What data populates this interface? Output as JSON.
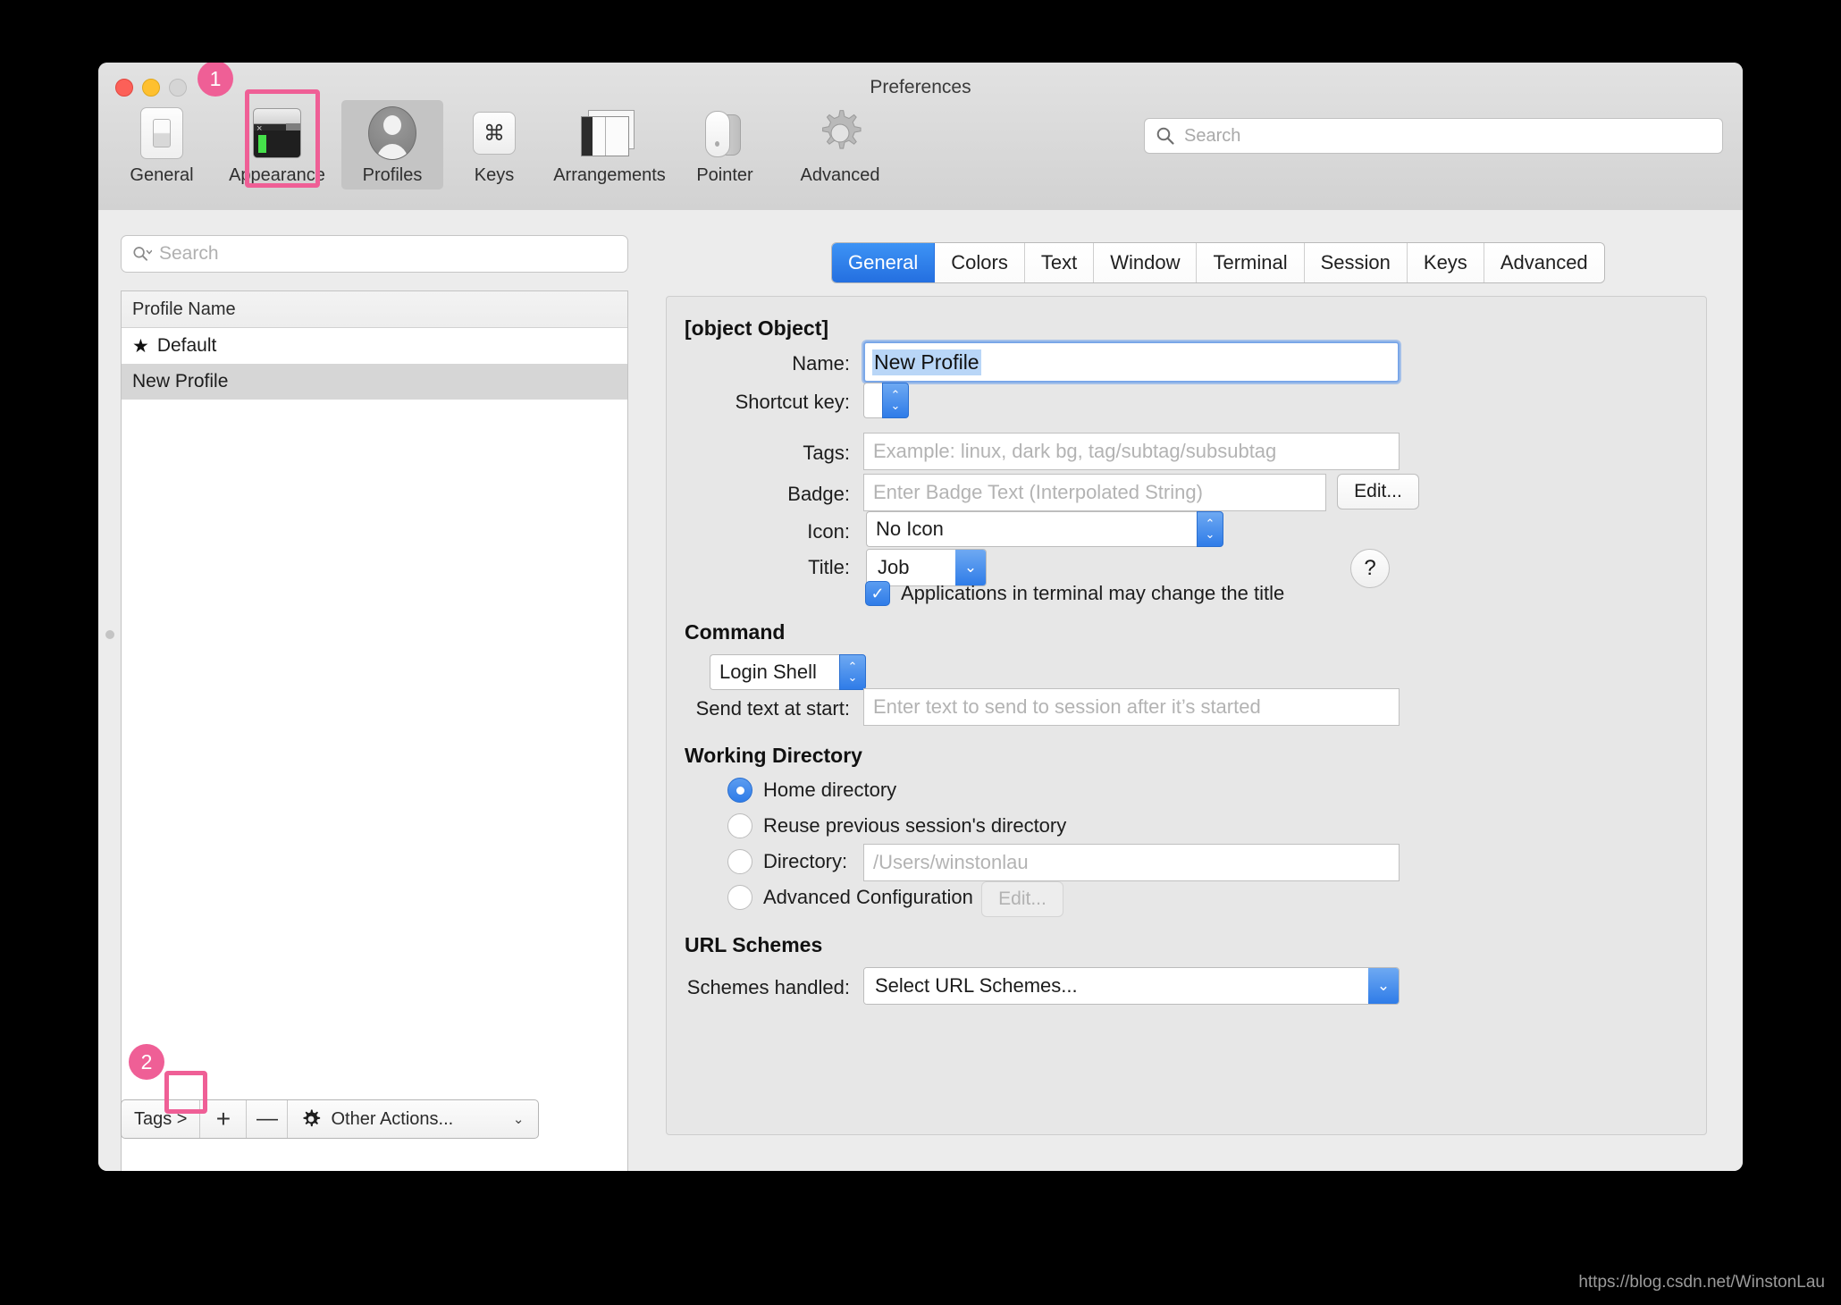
{
  "window": {
    "title": "Preferences",
    "traffic_lights": [
      "close",
      "minimize",
      "zoom"
    ]
  },
  "toolbar": {
    "items": [
      {
        "label": "General",
        "icon": "general-icon"
      },
      {
        "label": "Appearance",
        "icon": "appearance-icon"
      },
      {
        "label": "Profiles",
        "icon": "profiles-icon"
      },
      {
        "label": "Keys",
        "icon": "keys-icon"
      },
      {
        "label": "Arrangements",
        "icon": "arrangements-icon"
      },
      {
        "label": "Pointer",
        "icon": "pointer-icon"
      },
      {
        "label": "Advanced",
        "icon": "advanced-gear-icon"
      }
    ],
    "selected": "Profiles",
    "search": {
      "placeholder": "Search",
      "value": "",
      "icon": "search-icon"
    }
  },
  "sidebar": {
    "search": {
      "placeholder": "Search",
      "value": "",
      "icon": "search-icon"
    },
    "table": {
      "column_header": "Profile Name",
      "rows": [
        {
          "name": "Default",
          "starred": true,
          "selected": false,
          "star": "★"
        },
        {
          "name": "New Profile",
          "starred": false,
          "selected": true,
          "star": ""
        }
      ]
    },
    "bottom_bar": {
      "tags_label": "Tags >",
      "add_label": "+",
      "remove_label": "—",
      "other_actions_label": "Other Actions...",
      "other_actions_icon": "gear-icon",
      "caret": "⌄"
    }
  },
  "main": {
    "tabs": [
      {
        "label": "General",
        "active": true
      },
      {
        "label": "Colors",
        "active": false
      },
      {
        "label": "Text",
        "active": false
      },
      {
        "label": "Window",
        "active": false
      },
      {
        "label": "Terminal",
        "active": false
      },
      {
        "label": "Session",
        "active": false
      },
      {
        "label": "Keys",
        "active": false
      },
      {
        "label": "Advanced",
        "active": false
      }
    ],
    "sections": {
      "basics": {
        "title": {
          "label": "Title:",
          "value": "Job"
        },
        "name": {
          "label": "Name:",
          "value": "New Profile",
          "selected": true
        },
        "shortcut_key": {
          "label": "Shortcut key:",
          "value": ""
        },
        "tags": {
          "label": "Tags:",
          "value": "",
          "placeholder": "Example: linux, dark bg, tag/subtag/subsubtag"
        },
        "badge": {
          "label": "Badge:",
          "value": "",
          "placeholder": "Enter Badge Text (Interpolated String)",
          "edit_button": "Edit..."
        },
        "icon": {
          "label": "Icon:",
          "value": "No Icon"
        },
        "help_button": "?",
        "app_title_checkbox": {
          "label": "Applications in terminal may change the title",
          "checked": true,
          "check_glyph": "✓"
        }
      },
      "command": {
        "title": "Command",
        "shell": {
          "value": "Login Shell"
        },
        "send_text": {
          "label": "Send text at start:",
          "value": "",
          "placeholder": "Enter text to send to session after it’s started"
        }
      },
      "working_directory": {
        "title": "Working Directory",
        "options": [
          {
            "label": "Home directory",
            "selected": true
          },
          {
            "label": "Reuse previous session's directory",
            "selected": false
          },
          {
            "label": "Directory:",
            "selected": false
          },
          {
            "label": "Advanced Configuration",
            "selected": false
          }
        ],
        "directory_value": "",
        "directory_placeholder": "/Users/winstonlau",
        "advanced_edit_button": "Edit...",
        "advanced_edit_disabled": true
      },
      "url_schemes": {
        "title": "URL Schemes",
        "schemes_handled": {
          "label": "Schemes handled:",
          "value": "Select URL Schemes..."
        }
      }
    }
  },
  "annotations": [
    {
      "number": "1",
      "target": "Profiles toolbar item"
    },
    {
      "number": "2",
      "target": "Add profile button"
    }
  ],
  "watermark": "https://blog.csdn.net/WinstonLau",
  "colors": {
    "accent_blue": "#2f7ce8",
    "annotation_pink": "#ef5f96",
    "window_bg": "#ececec",
    "selection_blue": "#b9d6f7"
  }
}
